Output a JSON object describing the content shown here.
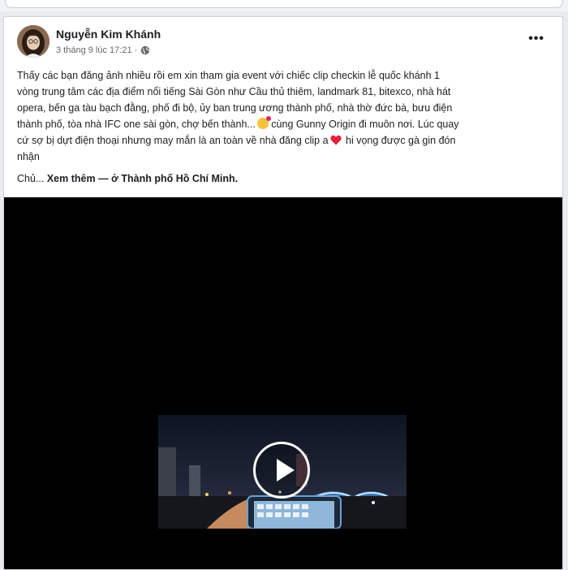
{
  "post": {
    "author": "Nguyễn Kim Khánh",
    "timestamp": "3 tháng 9 lúc 17:21 ·",
    "privacy_icon": "globe-icon",
    "more_options_icon": "more-options-icon",
    "more_options_label": "•••",
    "text_lines": [
      "Thấy các bạn đăng ảnh nhiều rồi em xin tham gia event với chiếc clip checkin lễ quốc khánh 1",
      "vòng trung tâm các địa điểm nổi tiếng Sài Gòn như Cầu thủ thiêm, landmark 81, bitexco, nhà hát",
      "opera, bến ga tàu bạch đằng, phố đi bộ, ủy ban trung ương thành phố, nhà thờ đức bà, bưu điện",
      "thành phố, tòa nhà IFC one sài gòn, chợ bến thành...",
      " cùng Gunny Origin đi muôn nơi. Lúc quay",
      "cứ sợ bị dựt điện thoại nhưng may mắn là an toàn về nhà đăng clip a",
      " hi vọng được gà gin đón",
      "nhận"
    ],
    "truncated_prefix": "Chủ...",
    "see_more": "Xem thêm",
    "location": "— ở Thành phố Hồ Chí Minh."
  },
  "video": {
    "play_icon": "play-icon"
  },
  "colors": {
    "author": "#1c1e21",
    "meta": "#65676b",
    "video_bg": "#000000"
  }
}
